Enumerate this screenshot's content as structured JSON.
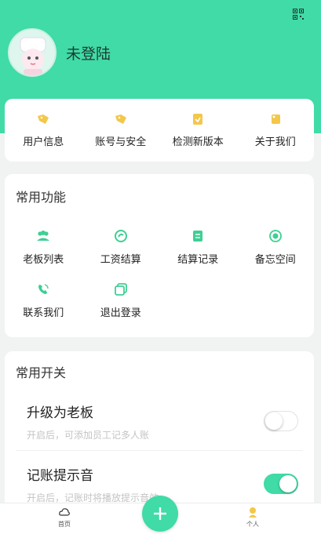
{
  "profile": {
    "username": "未登陆",
    "avatar_icon": "avatar-icon",
    "qr_icon": "qrcode-icon"
  },
  "colors": {
    "accent": "#40dba6",
    "icon_yellow": "#f3c74a",
    "icon_green": "#3ecf94"
  },
  "top_menu": [
    {
      "label": "用户信息",
      "icon": "tag-icon"
    },
    {
      "label": "账号与安全",
      "icon": "tag-icon"
    },
    {
      "label": "检测新版本",
      "icon": "version-icon"
    },
    {
      "label": "关于我们",
      "icon": "about-icon"
    }
  ],
  "functions": {
    "title": "常用功能",
    "items": [
      {
        "label": "老板列表",
        "icon": "users-icon"
      },
      {
        "label": "工资结算",
        "icon": "wage-icon"
      },
      {
        "label": "结算记录",
        "icon": "record-icon"
      },
      {
        "label": "备忘空间",
        "icon": "memo-icon"
      },
      {
        "label": "联系我们",
        "icon": "phone-icon"
      },
      {
        "label": "退出登录",
        "icon": "logout-icon"
      }
    ]
  },
  "switches": {
    "title": "常用开关",
    "items": [
      {
        "title": "升级为老板",
        "desc": "开启后，可添加员工记多人账",
        "enabled": false
      },
      {
        "title": "记账提示音",
        "desc": "开启后，记账时将播放提示音效",
        "enabled": true
      }
    ]
  },
  "tabbar": {
    "home_label": "首页",
    "personal_label": "个人"
  }
}
